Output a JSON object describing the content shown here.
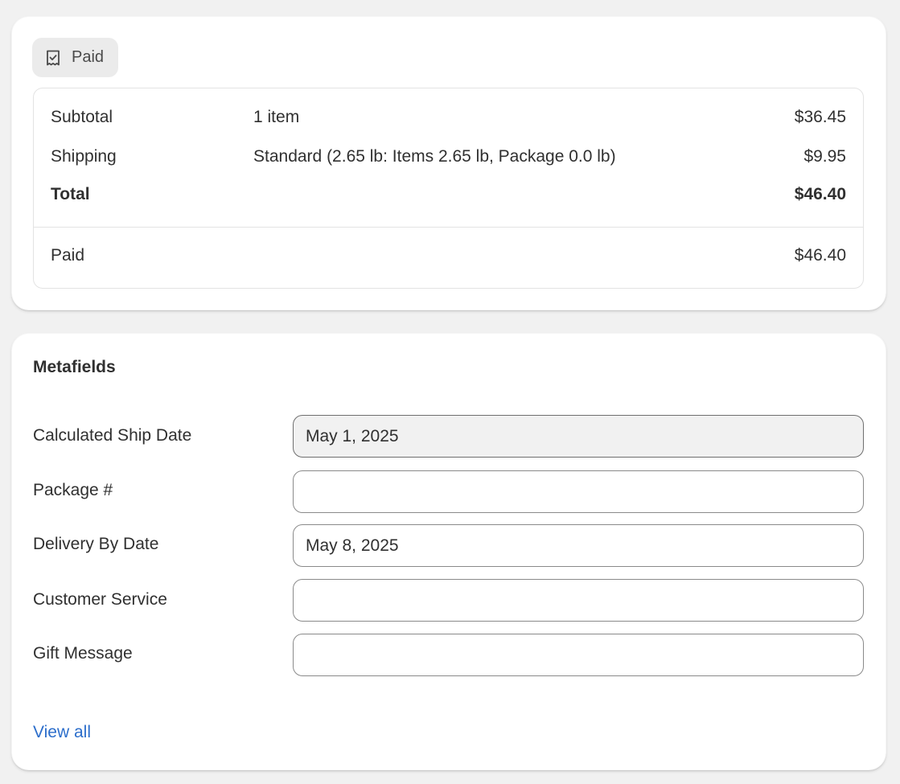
{
  "payment": {
    "badge": {
      "label": "Paid",
      "icon": "receipt-check-icon"
    },
    "rows": {
      "subtotal": {
        "label": "Subtotal",
        "detail": "1 item",
        "amount": "$36.45"
      },
      "shipping": {
        "label": "Shipping",
        "detail": "Standard (2.65 lb: Items 2.65 lb, Package 0.0 lb)",
        "amount": "$9.95"
      },
      "total": {
        "label": "Total",
        "amount": "$46.40"
      },
      "paid": {
        "label": "Paid",
        "amount": "$46.40"
      }
    }
  },
  "metafields": {
    "title": "Metafields",
    "fields": [
      {
        "label": "Calculated Ship Date",
        "value": "May 1, 2025",
        "readonly": true
      },
      {
        "label": "Package #",
        "value": ""
      },
      {
        "label": "Delivery By Date",
        "value": "May 8, 2025"
      },
      {
        "label": "Customer Service",
        "value": ""
      },
      {
        "label": "Gift Message",
        "value": ""
      }
    ],
    "view_all_label": "View all"
  },
  "colors": {
    "page_background": "#f1f1f1",
    "card_background": "#ffffff",
    "badge_background": "#ebebeb",
    "link": "#2c6ecb",
    "text": "#303030"
  }
}
